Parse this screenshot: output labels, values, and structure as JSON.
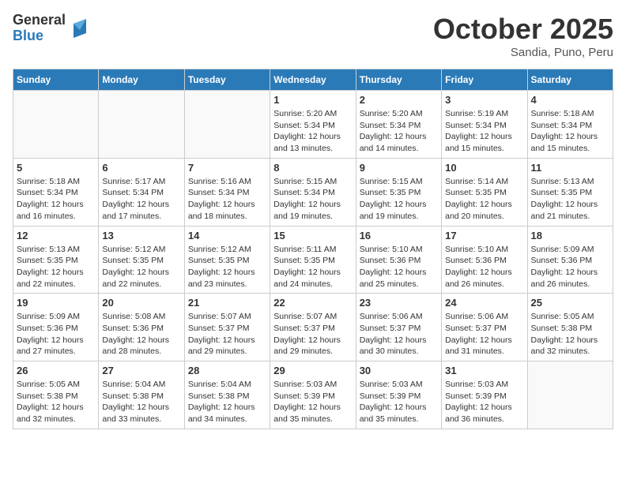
{
  "logo": {
    "general": "General",
    "blue": "Blue"
  },
  "title": "October 2025",
  "subtitle": "Sandia, Puno, Peru",
  "weekdays": [
    "Sunday",
    "Monday",
    "Tuesday",
    "Wednesday",
    "Thursday",
    "Friday",
    "Saturday"
  ],
  "weeks": [
    [
      {
        "day": "",
        "info": ""
      },
      {
        "day": "",
        "info": ""
      },
      {
        "day": "",
        "info": ""
      },
      {
        "day": "1",
        "info": "Sunrise: 5:20 AM\nSunset: 5:34 PM\nDaylight: 12 hours\nand 13 minutes."
      },
      {
        "day": "2",
        "info": "Sunrise: 5:20 AM\nSunset: 5:34 PM\nDaylight: 12 hours\nand 14 minutes."
      },
      {
        "day": "3",
        "info": "Sunrise: 5:19 AM\nSunset: 5:34 PM\nDaylight: 12 hours\nand 15 minutes."
      },
      {
        "day": "4",
        "info": "Sunrise: 5:18 AM\nSunset: 5:34 PM\nDaylight: 12 hours\nand 15 minutes."
      }
    ],
    [
      {
        "day": "5",
        "info": "Sunrise: 5:18 AM\nSunset: 5:34 PM\nDaylight: 12 hours\nand 16 minutes."
      },
      {
        "day": "6",
        "info": "Sunrise: 5:17 AM\nSunset: 5:34 PM\nDaylight: 12 hours\nand 17 minutes."
      },
      {
        "day": "7",
        "info": "Sunrise: 5:16 AM\nSunset: 5:34 PM\nDaylight: 12 hours\nand 18 minutes."
      },
      {
        "day": "8",
        "info": "Sunrise: 5:15 AM\nSunset: 5:34 PM\nDaylight: 12 hours\nand 19 minutes."
      },
      {
        "day": "9",
        "info": "Sunrise: 5:15 AM\nSunset: 5:35 PM\nDaylight: 12 hours\nand 19 minutes."
      },
      {
        "day": "10",
        "info": "Sunrise: 5:14 AM\nSunset: 5:35 PM\nDaylight: 12 hours\nand 20 minutes."
      },
      {
        "day": "11",
        "info": "Sunrise: 5:13 AM\nSunset: 5:35 PM\nDaylight: 12 hours\nand 21 minutes."
      }
    ],
    [
      {
        "day": "12",
        "info": "Sunrise: 5:13 AM\nSunset: 5:35 PM\nDaylight: 12 hours\nand 22 minutes."
      },
      {
        "day": "13",
        "info": "Sunrise: 5:12 AM\nSunset: 5:35 PM\nDaylight: 12 hours\nand 22 minutes."
      },
      {
        "day": "14",
        "info": "Sunrise: 5:12 AM\nSunset: 5:35 PM\nDaylight: 12 hours\nand 23 minutes."
      },
      {
        "day": "15",
        "info": "Sunrise: 5:11 AM\nSunset: 5:35 PM\nDaylight: 12 hours\nand 24 minutes."
      },
      {
        "day": "16",
        "info": "Sunrise: 5:10 AM\nSunset: 5:36 PM\nDaylight: 12 hours\nand 25 minutes."
      },
      {
        "day": "17",
        "info": "Sunrise: 5:10 AM\nSunset: 5:36 PM\nDaylight: 12 hours\nand 26 minutes."
      },
      {
        "day": "18",
        "info": "Sunrise: 5:09 AM\nSunset: 5:36 PM\nDaylight: 12 hours\nand 26 minutes."
      }
    ],
    [
      {
        "day": "19",
        "info": "Sunrise: 5:09 AM\nSunset: 5:36 PM\nDaylight: 12 hours\nand 27 minutes."
      },
      {
        "day": "20",
        "info": "Sunrise: 5:08 AM\nSunset: 5:36 PM\nDaylight: 12 hours\nand 28 minutes."
      },
      {
        "day": "21",
        "info": "Sunrise: 5:07 AM\nSunset: 5:37 PM\nDaylight: 12 hours\nand 29 minutes."
      },
      {
        "day": "22",
        "info": "Sunrise: 5:07 AM\nSunset: 5:37 PM\nDaylight: 12 hours\nand 29 minutes."
      },
      {
        "day": "23",
        "info": "Sunrise: 5:06 AM\nSunset: 5:37 PM\nDaylight: 12 hours\nand 30 minutes."
      },
      {
        "day": "24",
        "info": "Sunrise: 5:06 AM\nSunset: 5:37 PM\nDaylight: 12 hours\nand 31 minutes."
      },
      {
        "day": "25",
        "info": "Sunrise: 5:05 AM\nSunset: 5:38 PM\nDaylight: 12 hours\nand 32 minutes."
      }
    ],
    [
      {
        "day": "26",
        "info": "Sunrise: 5:05 AM\nSunset: 5:38 PM\nDaylight: 12 hours\nand 32 minutes."
      },
      {
        "day": "27",
        "info": "Sunrise: 5:04 AM\nSunset: 5:38 PM\nDaylight: 12 hours\nand 33 minutes."
      },
      {
        "day": "28",
        "info": "Sunrise: 5:04 AM\nSunset: 5:38 PM\nDaylight: 12 hours\nand 34 minutes."
      },
      {
        "day": "29",
        "info": "Sunrise: 5:03 AM\nSunset: 5:39 PM\nDaylight: 12 hours\nand 35 minutes."
      },
      {
        "day": "30",
        "info": "Sunrise: 5:03 AM\nSunset: 5:39 PM\nDaylight: 12 hours\nand 35 minutes."
      },
      {
        "day": "31",
        "info": "Sunrise: 5:03 AM\nSunset: 5:39 PM\nDaylight: 12 hours\nand 36 minutes."
      },
      {
        "day": "",
        "info": ""
      }
    ]
  ]
}
